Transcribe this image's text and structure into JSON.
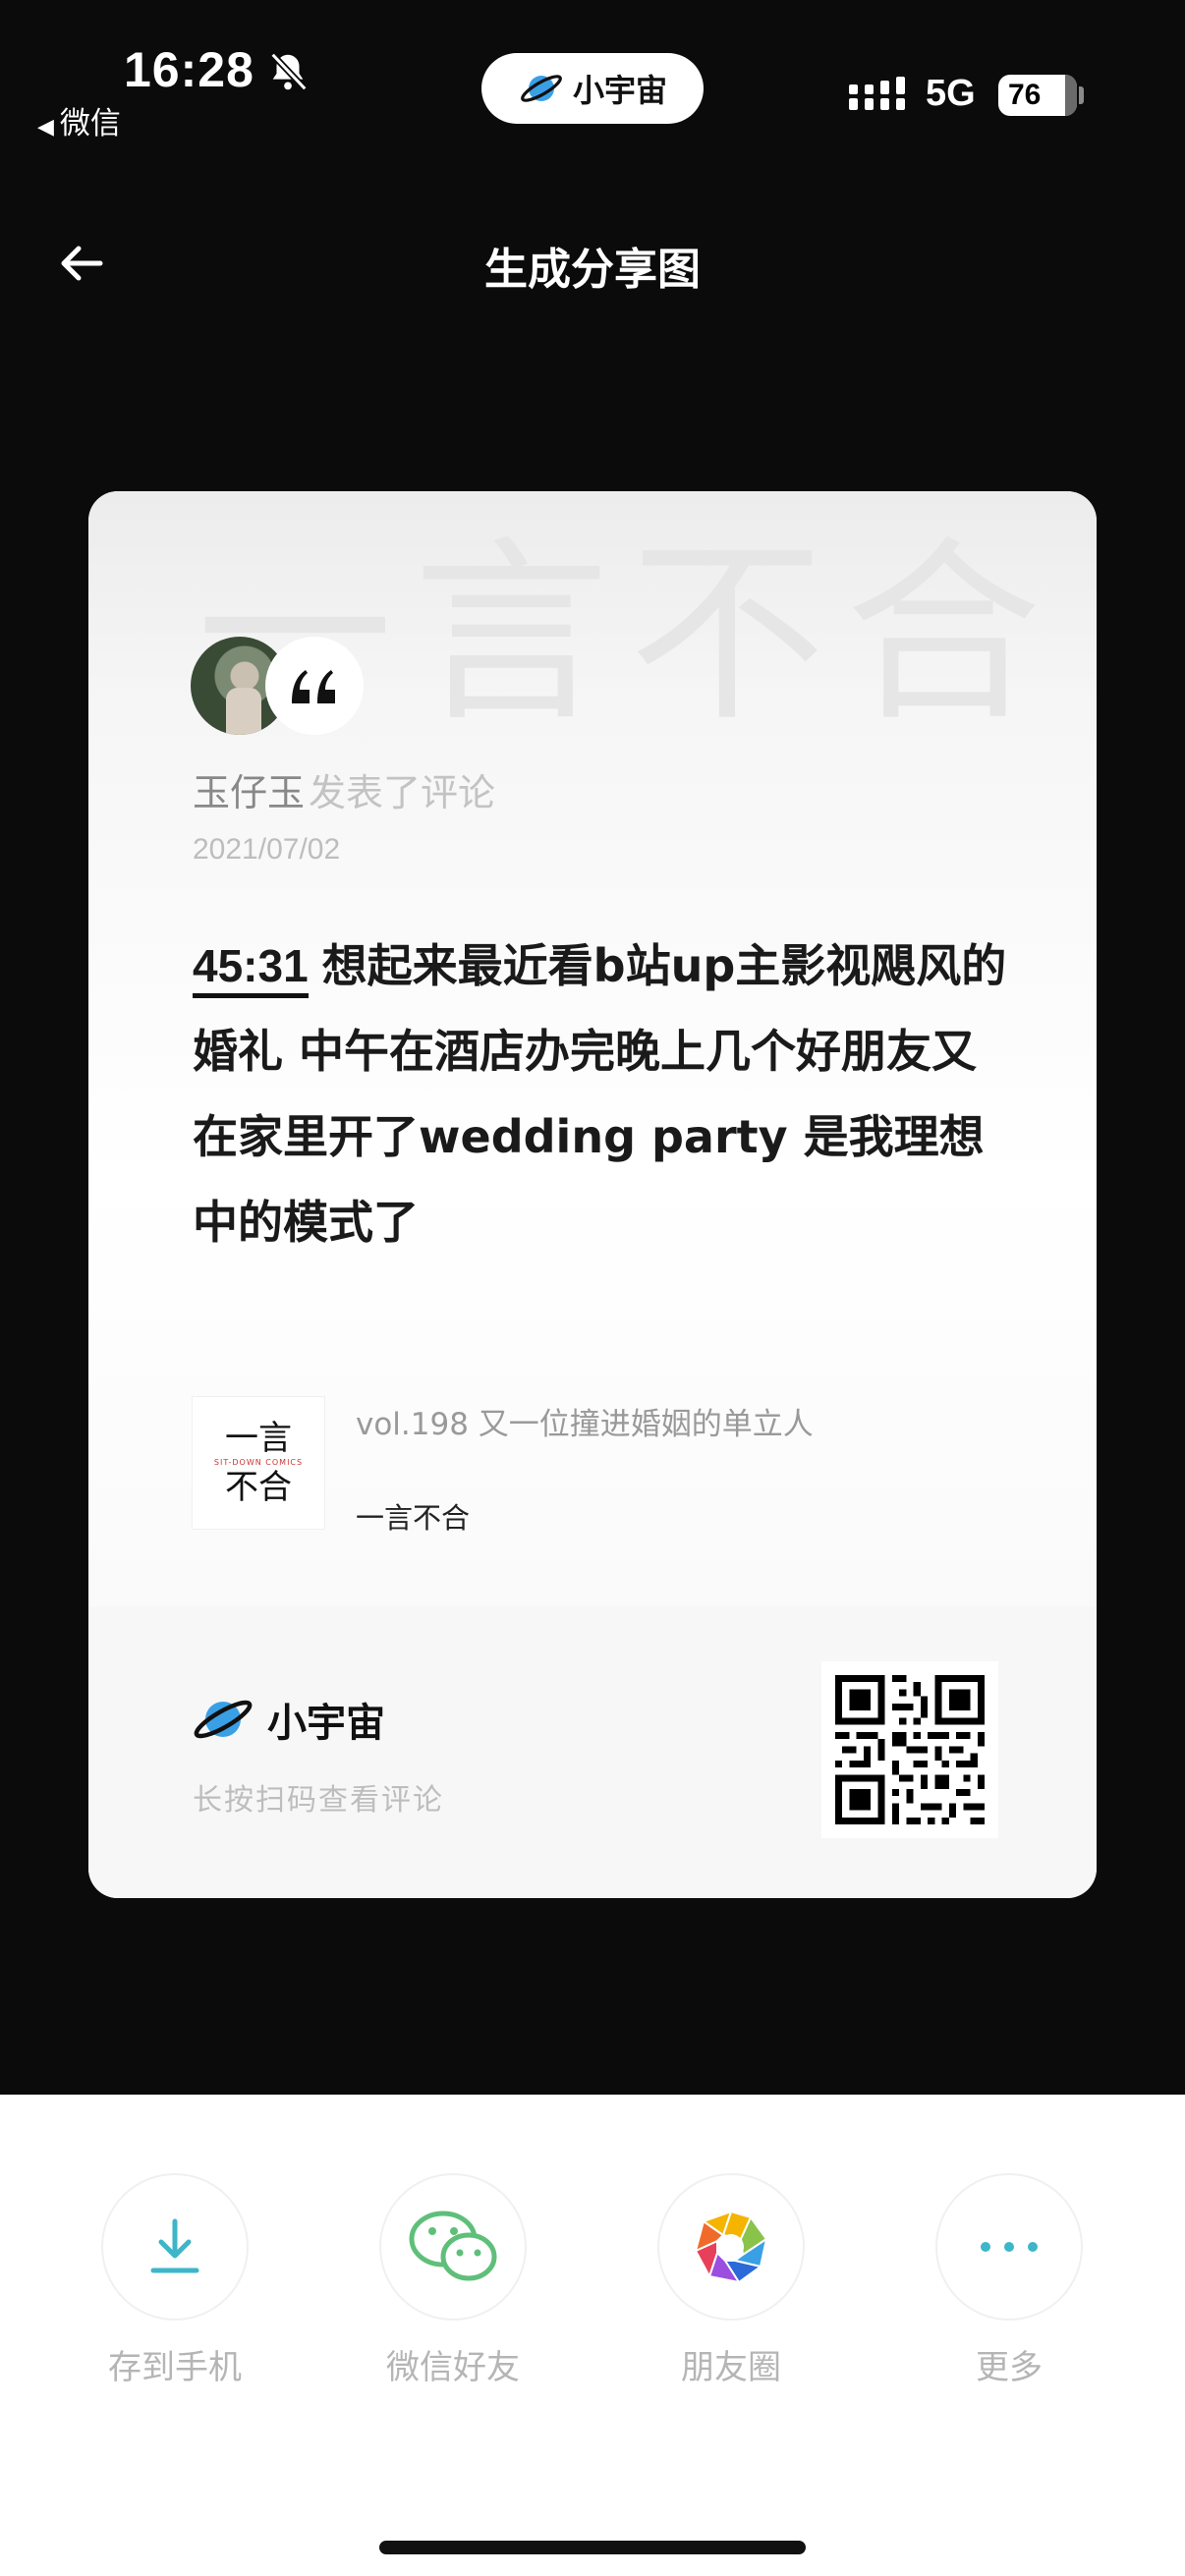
{
  "status_bar": {
    "time": "16:28",
    "back_app": "微信",
    "network": "5G",
    "battery": "76"
  },
  "mini_program": {
    "brand": "小宇宙"
  },
  "nav": {
    "title": "生成分享图"
  },
  "card": {
    "watermark": "一言不合",
    "author_name": "玉仔玉",
    "author_action": "发表了评论",
    "date": "2021/07/02",
    "timestamp": "45:31",
    "comment": "想起来最近看b站up主影视飓风的婚礼 中午在酒店办完晚上几个好朋友又在家里开了wedding party 是我理想中的模式了",
    "episode_title": "vol.198 又一位撞进婚姻的单立人",
    "podcast_name": "一言不合",
    "cover_line1": "一言",
    "cover_sub": "SIT-DOWN COMICS",
    "cover_line2": "不合",
    "brand": "小宇宙",
    "scan_hint": "长按扫码查看评论"
  },
  "share": {
    "items": [
      {
        "label": "存到手机",
        "icon": "download-icon"
      },
      {
        "label": "微信好友",
        "icon": "wechat-icon"
      },
      {
        "label": "朋友圈",
        "icon": "moments-icon"
      },
      {
        "label": "更多",
        "icon": "more-icon"
      }
    ]
  },
  "colors": {
    "background": "#0b0b0b",
    "planet_blue": "#3aa0e6",
    "download_teal": "#3cb6c8",
    "wechat_green": "#5fbf7a"
  }
}
